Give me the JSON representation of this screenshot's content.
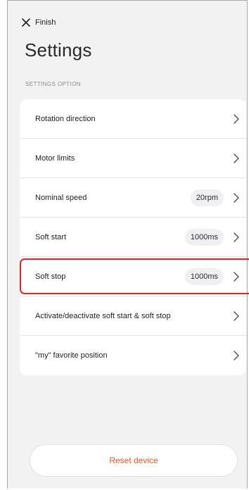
{
  "header": {
    "finish_label": "Finish",
    "title": "Settings",
    "section_label": "SETTINGS OPTION"
  },
  "settings": {
    "rows": [
      {
        "label": "Rotation direction",
        "value": ""
      },
      {
        "label": "Motor limits",
        "value": ""
      },
      {
        "label": "Nominal speed",
        "value": "20rpm"
      },
      {
        "label": "Soft start",
        "value": "1000ms"
      },
      {
        "label": "Soft stop",
        "value": "1000ms"
      },
      {
        "label": "Activate/deactivate soft start & soft stop",
        "value": ""
      },
      {
        "label": "\"my\" favorite position",
        "value": ""
      }
    ]
  },
  "footer": {
    "reset_label": "Reset device"
  },
  "colors": {
    "background": "#f2f2f2",
    "accent": "#ec5a24",
    "highlight": "#e0212e"
  },
  "icons": {
    "close": "close-icon",
    "chevron": "chevron-right-icon"
  }
}
